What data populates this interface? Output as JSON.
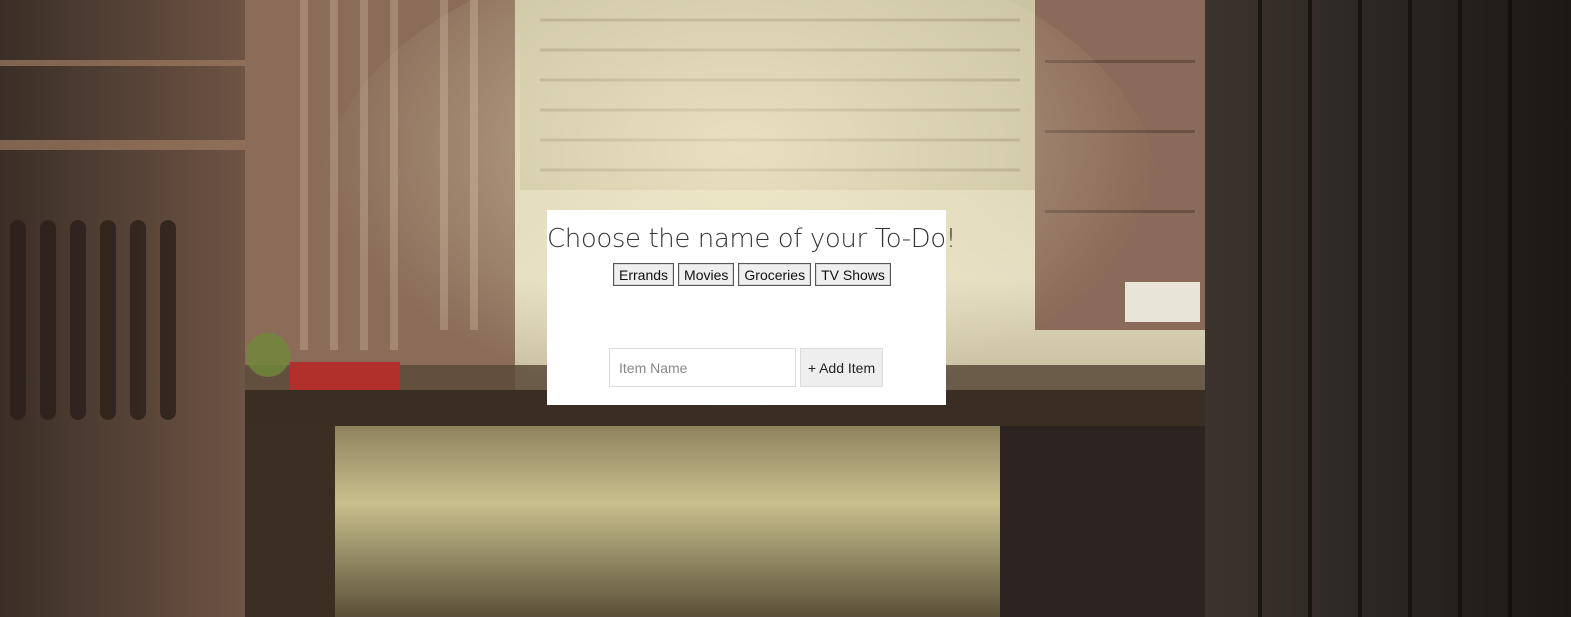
{
  "page": {
    "title": "Choose the name of your To-Do!"
  },
  "categories": [
    {
      "label": "Errands"
    },
    {
      "label": "Movies"
    },
    {
      "label": "Groceries"
    },
    {
      "label": "TV Shows"
    }
  ],
  "new_item": {
    "placeholder": "Item Name",
    "value": "",
    "add_icon": "+",
    "add_label": "Add Item"
  },
  "theme": {
    "card_background": "#ffffff",
    "button_background": "#efefef"
  }
}
